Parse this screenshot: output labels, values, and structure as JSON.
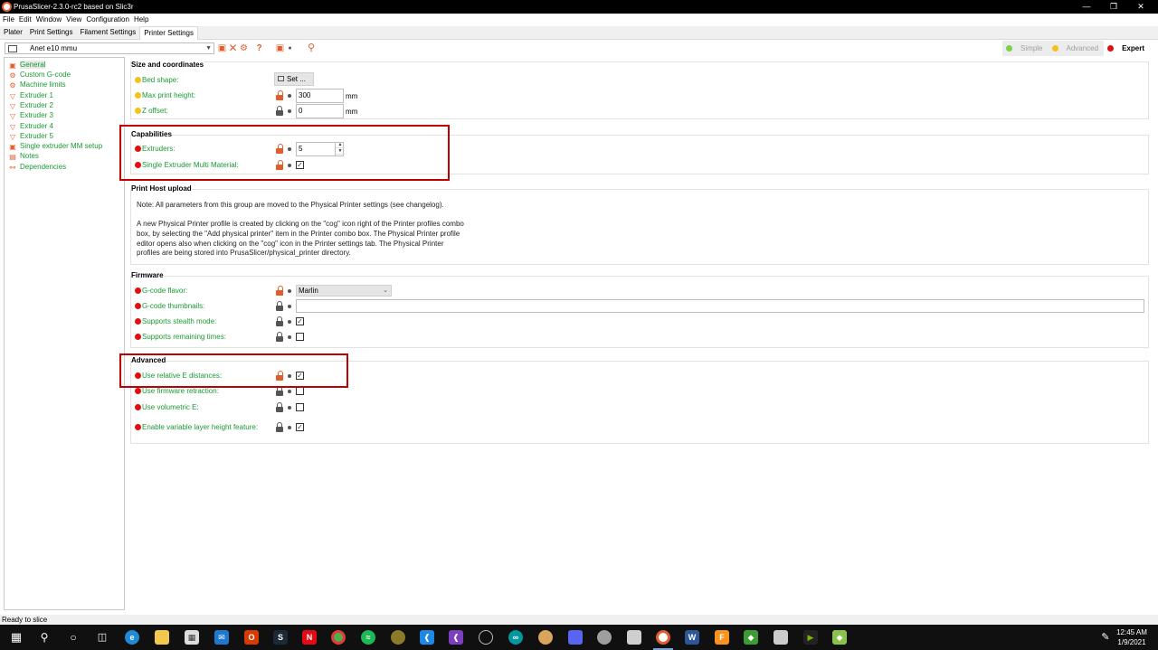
{
  "window": {
    "title": "PrusaSlicer-2.3.0-rc2 based on Slic3r"
  },
  "menu": [
    "File",
    "Edit",
    "Window",
    "View",
    "Configuration",
    "Help"
  ],
  "tabs": [
    "Plater",
    "Print Settings",
    "Filament Settings",
    "Printer Settings"
  ],
  "active_tab": "Printer Settings",
  "preset": {
    "selected": "Anet e10 mmu"
  },
  "modes": [
    {
      "label": "Simple",
      "color": "#7cd244",
      "active": false
    },
    {
      "label": "Advanced",
      "color": "#f5c21c",
      "active": false
    },
    {
      "label": "Expert",
      "color": "#e01010",
      "active": true
    }
  ],
  "pages": [
    "General",
    "Custom G-code",
    "Machine limits",
    "Extruder 1",
    "Extruder 2",
    "Extruder 3",
    "Extruder 4",
    "Extruder 5",
    "Single extruder MM setup",
    "Notes",
    "Dependencies"
  ],
  "size_coords": {
    "title": "Size and coordinates",
    "bed_shape_label": "Bed shape:",
    "bed_shape_button": "Set ...",
    "max_print_height_label": "Max print height:",
    "max_print_height_value": "300",
    "z_offset_label": "Z offset:",
    "z_offset_value": "0",
    "unit": "mm"
  },
  "capabilities": {
    "title": "Capabilities",
    "extruders_label": "Extruders:",
    "extruders_value": "5",
    "single_mm_label": "Single Extruder Multi Material:",
    "single_mm_checked": true
  },
  "print_host": {
    "title": "Print Host upload",
    "note1": "Note: All parameters from this group are moved to the Physical Printer settings (see changelog).",
    "note2_lines": [
      "A new Physical Printer profile is created by clicking on the \"cog\" icon right of the Printer profiles combo",
      "box, by selecting the \"Add physical printer\" item in the Printer combo box. The Physical Printer profile",
      "editor opens also when clicking on the \"cog\" icon in the Printer settings tab. The Physical Printer",
      "profiles are being stored into PrusaSlicer/physical_printer directory."
    ]
  },
  "firmware": {
    "title": "Firmware",
    "gcode_flavor_label": "G-code flavor:",
    "gcode_flavor_value": "Marlin",
    "thumbnails_label": "G-code thumbnails:",
    "thumbnails_value": "",
    "stealth_label": "Supports stealth mode:",
    "stealth_checked": true,
    "remaining_label": "Supports remaining times:",
    "remaining_checked": false
  },
  "advanced": {
    "title": "Advanced",
    "relative_e_label": "Use relative E distances:",
    "relative_e_checked": true,
    "fw_retraction_label": "Use firmware retraction:",
    "fw_retraction_checked": false,
    "volumetric_label": "Use volumetric E:",
    "volumetric_checked": false,
    "var_layer_label": "Enable variable layer height feature:",
    "var_layer_checked": true
  },
  "status": "Ready to slice",
  "clock": {
    "time": "12:45 AM",
    "date": "1/9/2021"
  },
  "colors": {
    "accent": "#e35d2c",
    "label_green": "#1a9a33",
    "highlight": "#c00000",
    "simple": "#f5c21c",
    "expert": "#e01010"
  }
}
